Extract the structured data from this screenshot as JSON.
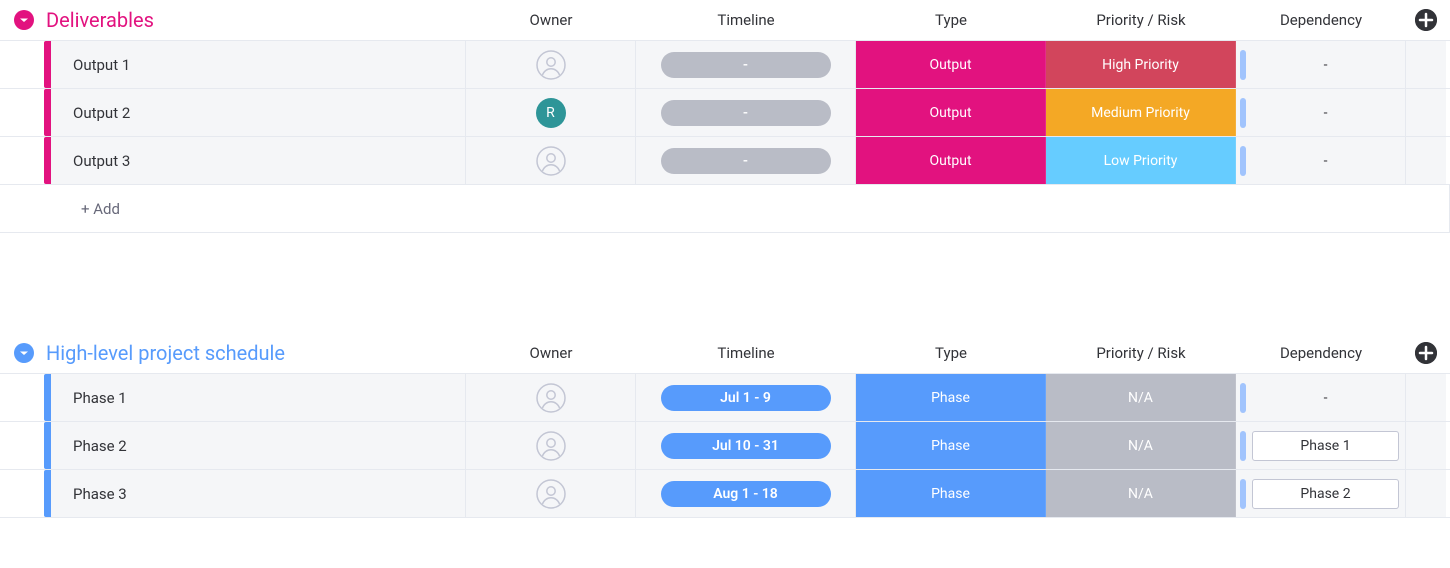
{
  "columns": {
    "owner": "Owner",
    "timeline": "Timeline",
    "type": "Type",
    "priority": "Priority / Risk",
    "dependency": "Dependency"
  },
  "add_row_label": "+ Add",
  "colors": {
    "pink": "#e2127f",
    "blue": "#579bfc",
    "grey_pill": "#b9bcc6",
    "grey_tag": "#b9bcc6",
    "output": "#e2127f",
    "phase": "#579bfc",
    "high": "#d2455c",
    "medium": "#f4a825",
    "low": "#66ccff",
    "na": "#b9bcc6",
    "dep_accent": "#a1c4fd",
    "avatar_teal": "#2e9598"
  },
  "groups": [
    {
      "id": "deliverables",
      "title": "Deliverables",
      "accent": "#e2127f",
      "title_color": "#e2127f",
      "rows": [
        {
          "name": "Output 1",
          "owner": {
            "type": "empty"
          },
          "timeline": {
            "text": "-",
            "bg": "#b9bcc6"
          },
          "type": {
            "text": "Output",
            "bg": "#e2127f"
          },
          "priority": {
            "text": "High Priority",
            "bg": "#d2455c"
          },
          "dependency": {
            "text": "-",
            "boxed": false
          }
        },
        {
          "name": "Output 2",
          "owner": {
            "type": "initial",
            "initial": "R",
            "bg": "#2e9598"
          },
          "timeline": {
            "text": "-",
            "bg": "#b9bcc6"
          },
          "type": {
            "text": "Output",
            "bg": "#e2127f"
          },
          "priority": {
            "text": "Medium Priority",
            "bg": "#f4a825"
          },
          "dependency": {
            "text": "-",
            "boxed": false
          }
        },
        {
          "name": "Output 3",
          "owner": {
            "type": "empty"
          },
          "timeline": {
            "text": "-",
            "bg": "#b9bcc6"
          },
          "type": {
            "text": "Output",
            "bg": "#e2127f"
          },
          "priority": {
            "text": "Low Priority",
            "bg": "#66ccff"
          },
          "dependency": {
            "text": "-",
            "boxed": false
          }
        }
      ],
      "show_add": true
    },
    {
      "id": "schedule",
      "title": "High-level project schedule",
      "accent": "#579bfc",
      "title_color": "#579bfc",
      "rows": [
        {
          "name": "Phase 1",
          "owner": {
            "type": "empty"
          },
          "timeline": {
            "text": "Jul 1 - 9",
            "bg": "#579bfc"
          },
          "type": {
            "text": "Phase",
            "bg": "#579bfc"
          },
          "priority": {
            "text": "N/A",
            "bg": "#b9bcc6"
          },
          "dependency": {
            "text": "-",
            "boxed": false
          }
        },
        {
          "name": "Phase 2",
          "owner": {
            "type": "empty"
          },
          "timeline": {
            "text": "Jul 10 - 31",
            "bg": "#579bfc"
          },
          "type": {
            "text": "Phase",
            "bg": "#579bfc"
          },
          "priority": {
            "text": "N/A",
            "bg": "#b9bcc6"
          },
          "dependency": {
            "text": "Phase 1",
            "boxed": true
          }
        },
        {
          "name": "Phase 3",
          "owner": {
            "type": "empty"
          },
          "timeline": {
            "text": "Aug 1 - 18",
            "bg": "#579bfc"
          },
          "type": {
            "text": "Phase",
            "bg": "#579bfc"
          },
          "priority": {
            "text": "N/A",
            "bg": "#b9bcc6"
          },
          "dependency": {
            "text": "Phase 2",
            "boxed": true
          }
        }
      ],
      "show_add": false
    }
  ]
}
